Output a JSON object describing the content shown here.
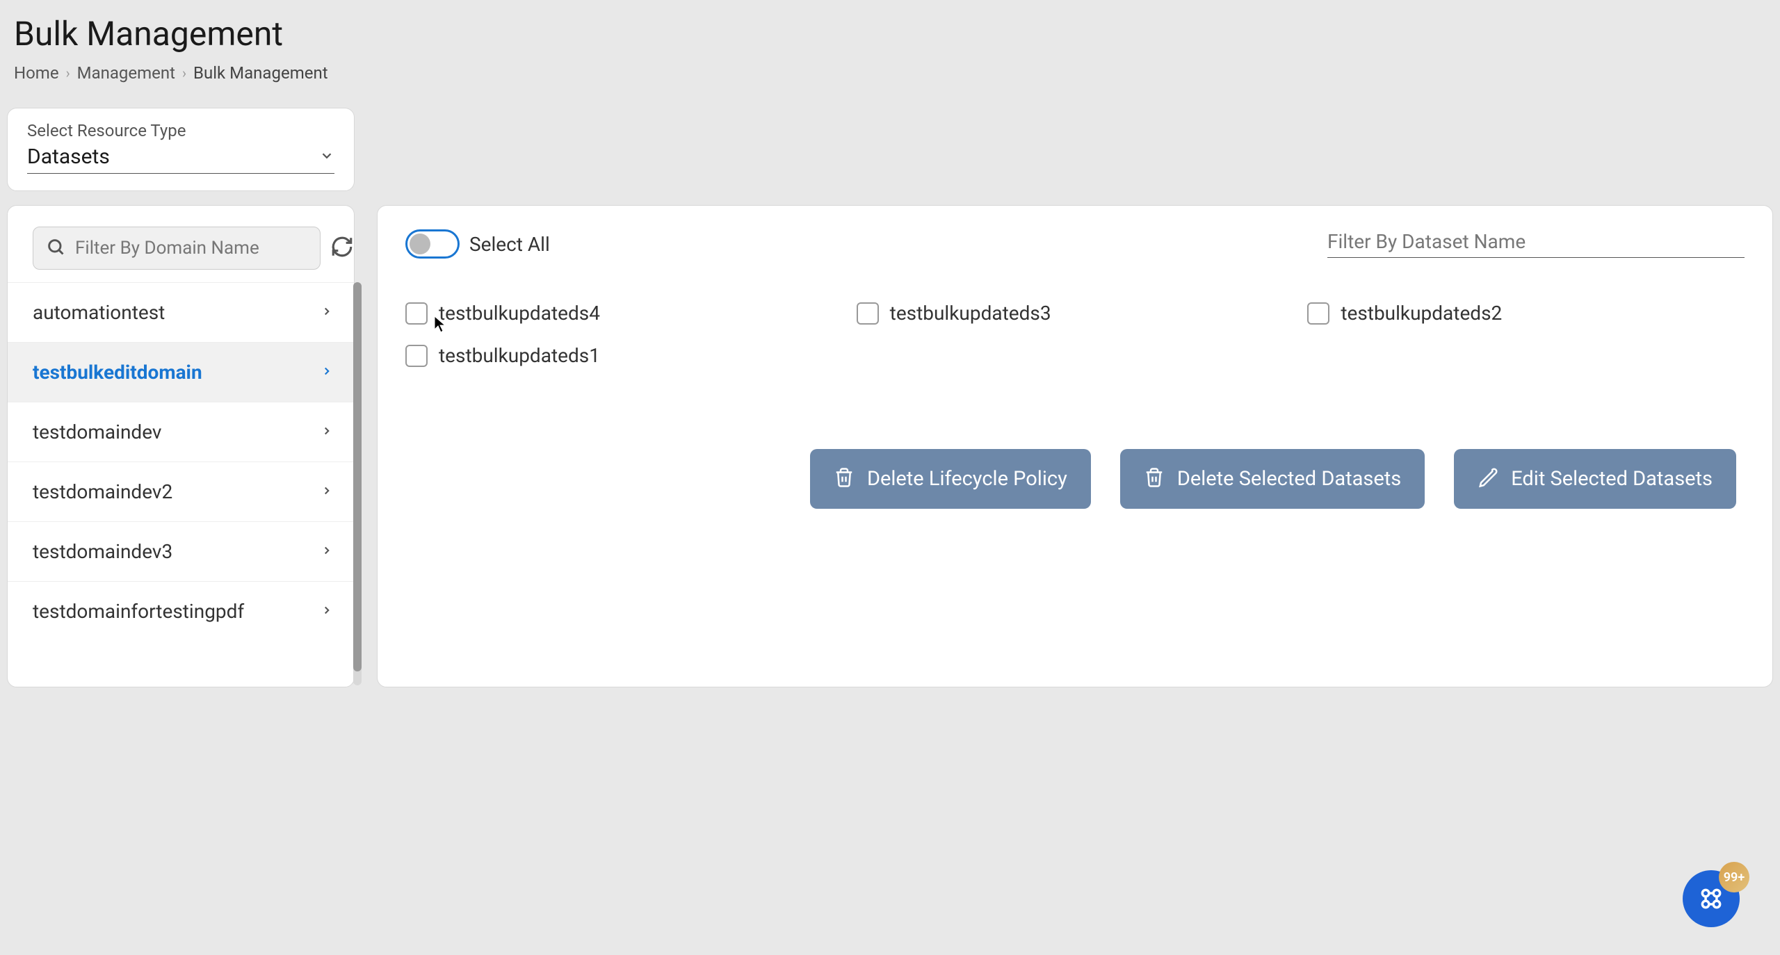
{
  "header": {
    "title": "Bulk Management",
    "breadcrumb": {
      "home": "Home",
      "management": "Management",
      "current": "Bulk Management"
    }
  },
  "resourceType": {
    "label": "Select Resource Type",
    "value": "Datasets"
  },
  "domainFilter": {
    "placeholder": "Filter By Domain Name"
  },
  "domains": [
    {
      "label": "automationtest",
      "selected": false
    },
    {
      "label": "testbulkeditdomain",
      "selected": true
    },
    {
      "label": "testdomaindev",
      "selected": false
    },
    {
      "label": "testdomaindev2",
      "selected": false
    },
    {
      "label": "testdomaindev3",
      "selected": false
    },
    {
      "label": "testdomainfortestingpdf",
      "selected": false
    }
  ],
  "main": {
    "selectAllLabel": "Select All",
    "datasetFilterPlaceholder": "Filter By Dataset Name",
    "datasets": [
      {
        "label": "testbulkupdateds4"
      },
      {
        "label": "testbulkupdateds3"
      },
      {
        "label": "testbulkupdateds2"
      },
      {
        "label": "testbulkupdateds1"
      }
    ],
    "buttons": {
      "deleteLifecycle": "Delete Lifecycle Policy",
      "deleteSelected": "Delete Selected Datasets",
      "editSelected": "Edit Selected Datasets"
    }
  },
  "fab": {
    "badge": "99+"
  }
}
